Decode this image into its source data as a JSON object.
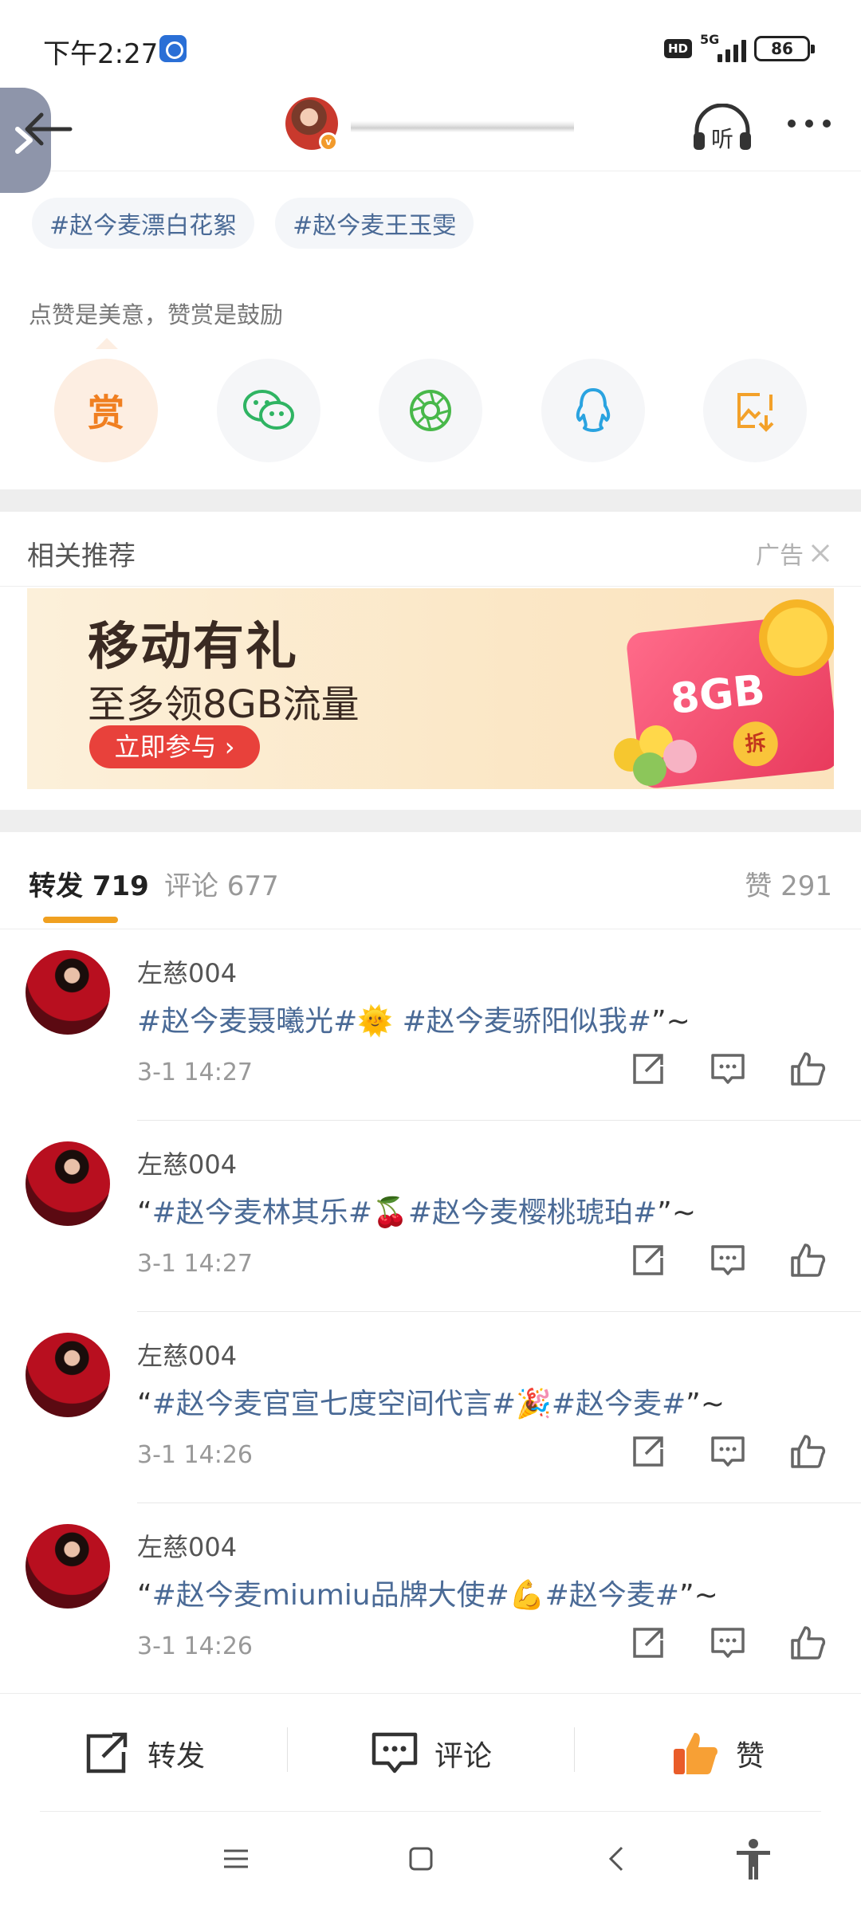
{
  "status_bar": {
    "time": "下午2:27",
    "hd": "HD",
    "network": "5G",
    "battery": "86"
  },
  "header": {
    "back_icon": "back-arrow-icon",
    "listen_label": "听",
    "more_icon": "more-dots-icon"
  },
  "topics": [
    "#赵今麦漂白花絮",
    "#赵今麦王玉雯"
  ],
  "reward_hint": "点赞是美意，赞赏是鼓励",
  "share_buttons": [
    {
      "name": "reward",
      "label": "赏",
      "color": "#f07f21"
    },
    {
      "name": "wechat",
      "icon": "wechat-icon",
      "color": "#2fb463"
    },
    {
      "name": "moments",
      "icon": "moments-icon",
      "color": "#48b84a"
    },
    {
      "name": "qq",
      "icon": "qq-icon",
      "color": "#2aa3e0"
    },
    {
      "name": "save-image",
      "icon": "save-image-icon",
      "color": "#f3a12a"
    }
  ],
  "related": {
    "title": "相关推荐",
    "ad_label": "广告"
  },
  "ad": {
    "title": "移动有礼",
    "subtitle": "至多领8GB流量",
    "cta": "立即参与",
    "card_text": "8GB",
    "card_badge": "拆"
  },
  "tabs": {
    "repost": "转发 719",
    "comment": "评论 677",
    "like": "赞 291"
  },
  "reposts": [
    {
      "user": "左慈004",
      "text_before": "",
      "tag1": "#赵今麦聂曦光#",
      "emoji": "🌞",
      "tag2": "#赵今麦骄阳似我#",
      "suffix": "”~",
      "time": "3-1 14:27",
      "lead_space": " "
    },
    {
      "user": "左慈004",
      "text_before": "“",
      "tag1": "#赵今麦林其乐#",
      "emoji": "🍒",
      "tag2": "#赵今麦樱桃琥珀#",
      "suffix": "”~",
      "time": "3-1 14:27",
      "lead_space": ""
    },
    {
      "user": "左慈004",
      "text_before": "“",
      "tag1": "#赵今麦官宣七度空间代言#",
      "emoji": "🎉",
      "tag2": "#赵今麦#",
      "suffix": "”~",
      "time": "3-1 14:26",
      "lead_space": ""
    },
    {
      "user": "左慈004",
      "text_before": "“",
      "tag1": "#赵今麦miumiu品牌大使#",
      "emoji": "💪",
      "tag2": "#赵今麦#",
      "suffix": "”~",
      "time": "3-1 14:26",
      "lead_space": ""
    }
  ],
  "action_bar": {
    "repost": "转发",
    "comment": "评论",
    "like": "赞"
  }
}
